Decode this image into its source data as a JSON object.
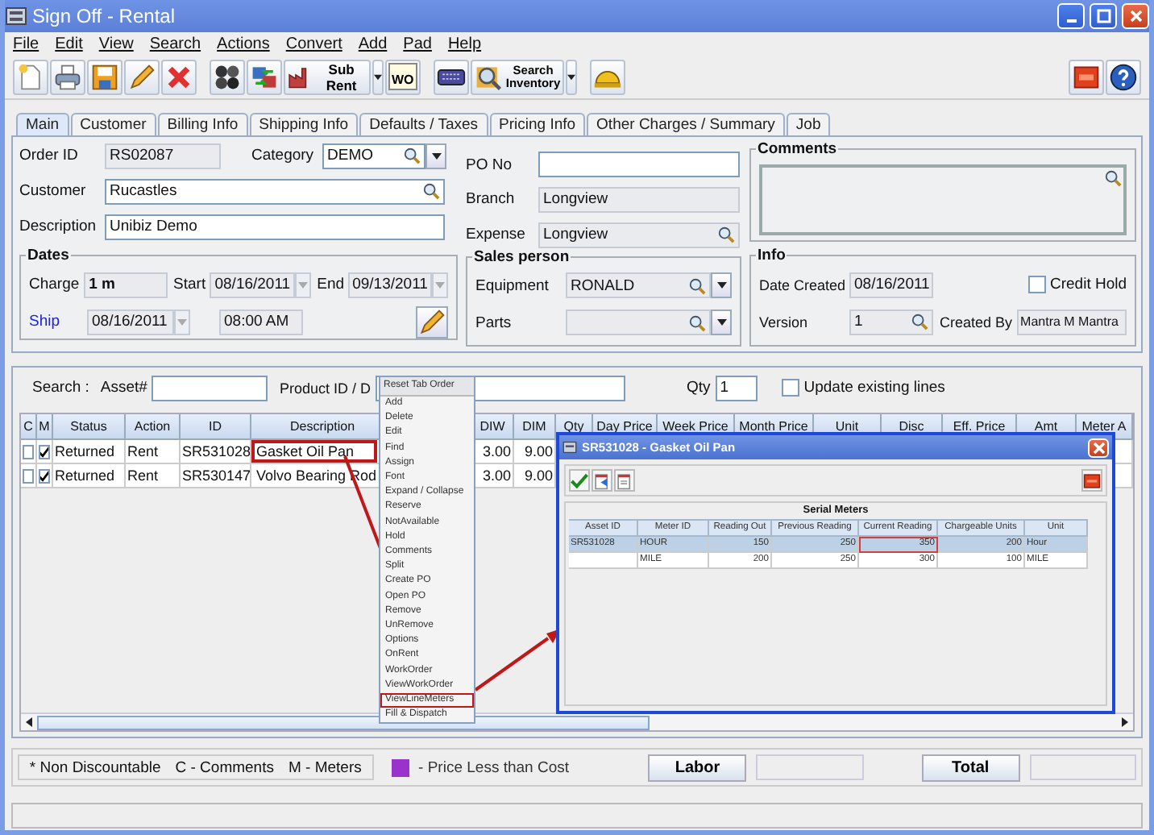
{
  "window": {
    "title": "Sign Off - Rental"
  },
  "menu": [
    "File",
    "Edit",
    "View",
    "Search",
    "Actions",
    "Convert",
    "Add",
    "Pad",
    "Help"
  ],
  "toolbar": {
    "sub_rent": "Sub Rent",
    "wo": "WO",
    "search_inventory": "Search Inventory"
  },
  "tabs": [
    {
      "label": "Main",
      "selected": true
    },
    {
      "label": "Customer",
      "selected": false
    },
    {
      "label": "Billing Info",
      "selected": false
    },
    {
      "label": "Shipping Info",
      "selected": false
    },
    {
      "label": "Defaults / Taxes",
      "selected": false
    },
    {
      "label": "Pricing Info",
      "selected": false
    },
    {
      "label": "Other Charges / Summary",
      "selected": false
    },
    {
      "label": "Job",
      "selected": false
    }
  ],
  "main": {
    "order_id": {
      "label": "Order ID",
      "value": "RS02087"
    },
    "category": {
      "label": "Category",
      "value": "DEMO"
    },
    "customer": {
      "label": "Customer",
      "value": "Rucastles"
    },
    "description": {
      "label": "Description",
      "value": "Unibiz Demo"
    },
    "po_no": {
      "label": "PO No"
    },
    "branch": {
      "label": "Branch",
      "value": "Longview"
    },
    "expense": {
      "label": "Expense",
      "value": "Longview"
    },
    "comments": {
      "title": "Comments"
    },
    "dates": {
      "title": "Dates",
      "charge_label": "Charge",
      "charge": "1 m",
      "start_label": "Start",
      "start": "08/16/2011",
      "end_label": "End",
      "end": "09/13/2011",
      "ship_label": "Ship",
      "ship_date": "08/16/2011",
      "ship_time": "08:00 AM"
    },
    "sales_person": {
      "title": "Sales person",
      "equipment_label": "Equipment",
      "equipment": "RONALD",
      "parts_label": "Parts"
    },
    "info": {
      "title": "Info",
      "date_created_label": "Date Created",
      "date_created": "08/16/2011",
      "credit_hold": {
        "label": "Credit Hold",
        "checked": false
      },
      "version_label": "Version",
      "version": "1",
      "created_by_label": "Created By",
      "created_by": "Mantra M Mantra"
    }
  },
  "search": {
    "label": "Search :",
    "asset_label": "Asset#",
    "product_label": "Product ID / D",
    "qty_label": "Qty",
    "qty": "1",
    "update": {
      "label": "Update existing lines",
      "checked": false
    }
  },
  "grid": {
    "columns": [
      "C",
      "M",
      "Status",
      "Action",
      "ID",
      "Description",
      "DIW",
      "DIM",
      "Qty",
      "Day Price",
      "Week Price",
      "Month Price",
      "Unit",
      "Disc",
      "Eff. Price",
      "Amt",
      "Meter A"
    ],
    "rows": [
      {
        "c_checked": false,
        "m_checked": true,
        "status": "Returned",
        "action": "Rent",
        "id": "SR531028",
        "description": "Gasket Oil Pan",
        "highlighted": true,
        "diw": "3.00",
        "dim": "9.00"
      },
      {
        "c_checked": false,
        "m_checked": true,
        "status": "Returned",
        "action": "Rent",
        "id": "SR530147",
        "description": "Volvo Bearing Rod",
        "highlighted": false,
        "diw": "3.00",
        "dim": "9.00"
      }
    ]
  },
  "context_menu": {
    "title": "Reset Tab Order",
    "items": [
      {
        "label": "Add",
        "highlighted": false
      },
      {
        "label": "Delete",
        "highlighted": false
      },
      {
        "label": "Edit",
        "highlighted": false
      },
      {
        "label": "Find",
        "highlighted": false
      },
      {
        "label": "Assign",
        "highlighted": false
      },
      {
        "label": "Font",
        "highlighted": false
      },
      {
        "label": "Expand / Collapse",
        "highlighted": false
      },
      {
        "label": "Reserve",
        "highlighted": false
      },
      {
        "label": "NotAvailable",
        "highlighted": false
      },
      {
        "label": "Hold",
        "highlighted": false
      },
      {
        "label": "Comments",
        "highlighted": false
      },
      {
        "label": "Split",
        "highlighted": false
      },
      {
        "label": "Create PO",
        "highlighted": false
      },
      {
        "label": "Open PO",
        "highlighted": false
      },
      {
        "label": "Remove",
        "highlighted": false
      },
      {
        "label": "UnRemove",
        "highlighted": false
      },
      {
        "label": "Options",
        "highlighted": false
      },
      {
        "label": "OnRent",
        "highlighted": false
      },
      {
        "label": "WorkOrder",
        "highlighted": false
      },
      {
        "label": "ViewWorkOrder",
        "highlighted": false
      },
      {
        "label": "ViewLineMeters",
        "highlighted": true
      },
      {
        "label": "Fill & Dispatch",
        "highlighted": false
      }
    ]
  },
  "dialog": {
    "title": "SR531028 - Gasket Oil Pan",
    "section": "Serial Meters",
    "columns": [
      "Asset ID",
      "Meter ID",
      "Reading Out",
      "Previous Reading",
      "Current Reading",
      "Chargeable Units",
      "Unit"
    ],
    "rows": [
      {
        "selected": true,
        "cells": [
          {
            "text": "SR531028",
            "highlighted": false
          },
          {
            "text": "HOUR",
            "highlighted": false
          },
          {
            "text": "150",
            "highlighted": false
          },
          {
            "text": "250",
            "highlighted": false
          },
          {
            "text": "350",
            "highlighted": true
          },
          {
            "text": "200",
            "highlighted": false
          },
          {
            "text": "Hour",
            "highlighted": false
          }
        ]
      },
      {
        "selected": false,
        "cells": [
          {
            "highlighted": false
          },
          {
            "text": "MILE",
            "highlighted": false
          },
          {
            "text": "200",
            "highlighted": false
          },
          {
            "text": "250",
            "highlighted": false
          },
          {
            "text": "300",
            "highlighted": false
          },
          {
            "text": "100",
            "highlighted": false
          },
          {
            "text": "MILE",
            "highlighted": false
          }
        ]
      }
    ]
  },
  "footer": {
    "legend": [
      "* Non Discountable",
      "C - Comments",
      "M - Meters"
    ],
    "price_legend": {
      "color": "#9933cc",
      "label": "- Price Less than Cost"
    },
    "labor": "Labor",
    "total": "Total"
  }
}
